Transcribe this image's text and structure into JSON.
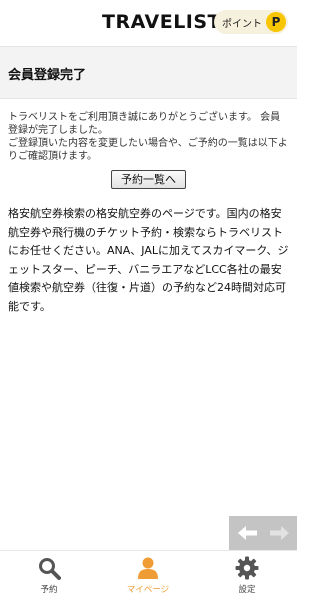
{
  "header": {
    "logo": "TRAVELIST",
    "point_label": "ポイント",
    "point_badge": "P"
  },
  "page_title": "会員登録完了",
  "message": {
    "line1": "トラベリストをご利用頂き誠にありがとうございます。 会員登録が完了しました。",
    "line2": "ご登録頂いた内容を変更したい場合や、ご予約の一覧は以下よりご確認頂けます。"
  },
  "reserve_list_button": "予約一覧へ",
  "description": "格安航空券検索の格安航空券のページです。国内の格安航空券や飛行機のチケット予約・検索ならトラベリストにお任せください。ANA、JALに加えてスカイマーク、ジェットスター、ピーチ、バニラエアなどLCC各社の最安値検索や航空券（往復・片道）の予約など24時間対応可能です。",
  "pager": {
    "prev_icon": "arrow-left-icon",
    "next_icon": "arrow-right-icon"
  },
  "tabbar": {
    "tabs": [
      {
        "label": "予約",
        "icon": "search-icon"
      },
      {
        "label": "マイページ",
        "icon": "person-icon"
      },
      {
        "label": "設定",
        "icon": "gear-icon"
      }
    ],
    "active_color": "#f09c35",
    "inactive_color": "#555555"
  }
}
